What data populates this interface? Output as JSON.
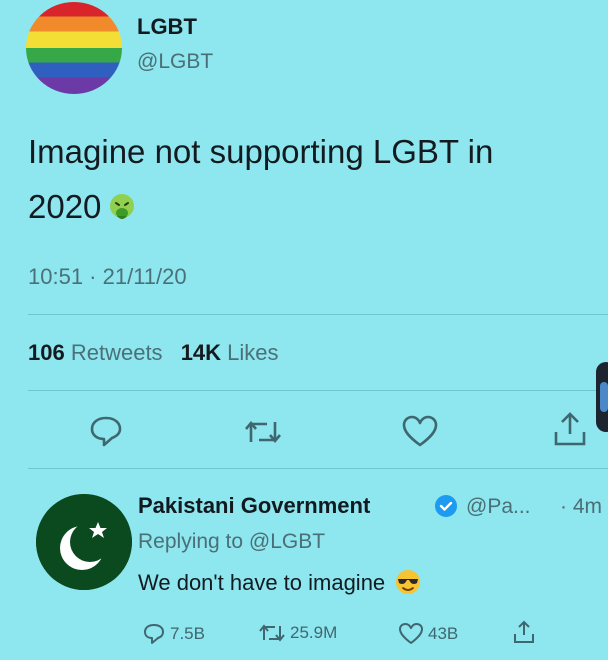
{
  "tweet": {
    "user_name": "LGBT",
    "handle": "@LGBT",
    "text": "Imagine not supporting LGBT in 2020",
    "emoji": "nauseated-face-emoji",
    "timestamp": "10:51 · 21/11/20",
    "retweets_count": "106",
    "retweets_label": "Retweets",
    "likes_count": "14K",
    "likes_label": "Likes"
  },
  "reply": {
    "user_name": "Pakistani Government",
    "handle": "@Pa...",
    "time": "· 4m",
    "replying_prefix": "Replying to",
    "replying_to": "@LGBT",
    "text": "We don't have to imagine",
    "emoji": "sunglasses-face-emoji",
    "replies_count": "7.5B",
    "retweets_count": "25.9M",
    "likes_count": "43B"
  },
  "colors": {
    "background": "#8ee6ee",
    "flag_green": "#0b4a1e",
    "verified_blue": "#1d9bf0"
  }
}
